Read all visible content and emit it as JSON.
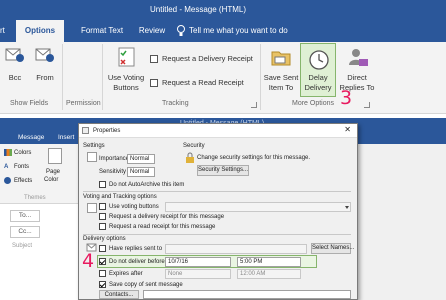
{
  "top_window": {
    "title_bar": "Untitled - Message (HTML)",
    "tabs": [
      {
        "label": "rt"
      },
      {
        "label": "Options"
      },
      {
        "label": "Format Text"
      },
      {
        "label": "Review"
      }
    ],
    "tell_me": "Tell me what you want to do",
    "fields_buttons": {
      "bcc": "Bcc",
      "from": "From"
    },
    "group_show_fields": "Show Fields",
    "group_permission": "Permission",
    "voting_buttons": {
      "line1": "Use Voting",
      "line2": "Buttons"
    },
    "request_delivery_receipt": "Request a Delivery Receipt",
    "request_read_receipt": "Request a Read Receipt",
    "group_tracking": "Tracking",
    "save_sent_item": {
      "line1": "Save Sent",
      "line2": "Item To"
    },
    "delay_delivery": {
      "line1": "Delay",
      "line2": "Delivery"
    },
    "direct_replies": {
      "line1": "Direct",
      "line2": "Replies To"
    },
    "group_more_options": "More Options",
    "step_number": "3",
    "accent_color": "#2b579a",
    "step_color": "#e81a5f"
  },
  "bottom_window": {
    "title_bar": "Untitled - Message (HTML)",
    "tabs": [
      {
        "label": "Message"
      },
      {
        "label": "Insert"
      }
    ],
    "theme_items": {
      "colors": "Colors",
      "fonts": "Fonts",
      "effects": "Effects",
      "page_color_1": "Page",
      "page_color_2": "Color",
      "group_themes": "Themes"
    },
    "form_fields": {
      "to": "To...",
      "cc": "Cc...",
      "subject": "Subject"
    },
    "step_number": "4"
  },
  "dialog": {
    "title": "Properties",
    "settings_header": "Settings",
    "importance_label": "Importance",
    "importance_value": "Normal",
    "sensitivity_label": "Sensitivity",
    "sensitivity_value": "Normal",
    "autoarchive": "Do not AutoArchive this item",
    "security_header": "Security",
    "security_text": "Change security settings for this message.",
    "security_button": "Security Settings...",
    "voting_header": "Voting and Tracking options",
    "use_voting": "Use voting buttons",
    "delivery_receipt": "Request a delivery receipt for this message",
    "read_receipt": "Request a read receipt for this message",
    "delivery_header": "Delivery options",
    "have_replies": "Have replies sent to",
    "select_names": "Select Names...",
    "do_not_deliver": "Do not deliver before",
    "deliver_date": "10/7/16",
    "deliver_time": "5:00 PM",
    "expires_after": "Expires after",
    "expires_date": "None",
    "expires_time": "12:00 AM",
    "save_copy": "Save copy of sent message",
    "contacts_button": "Contacts..."
  }
}
